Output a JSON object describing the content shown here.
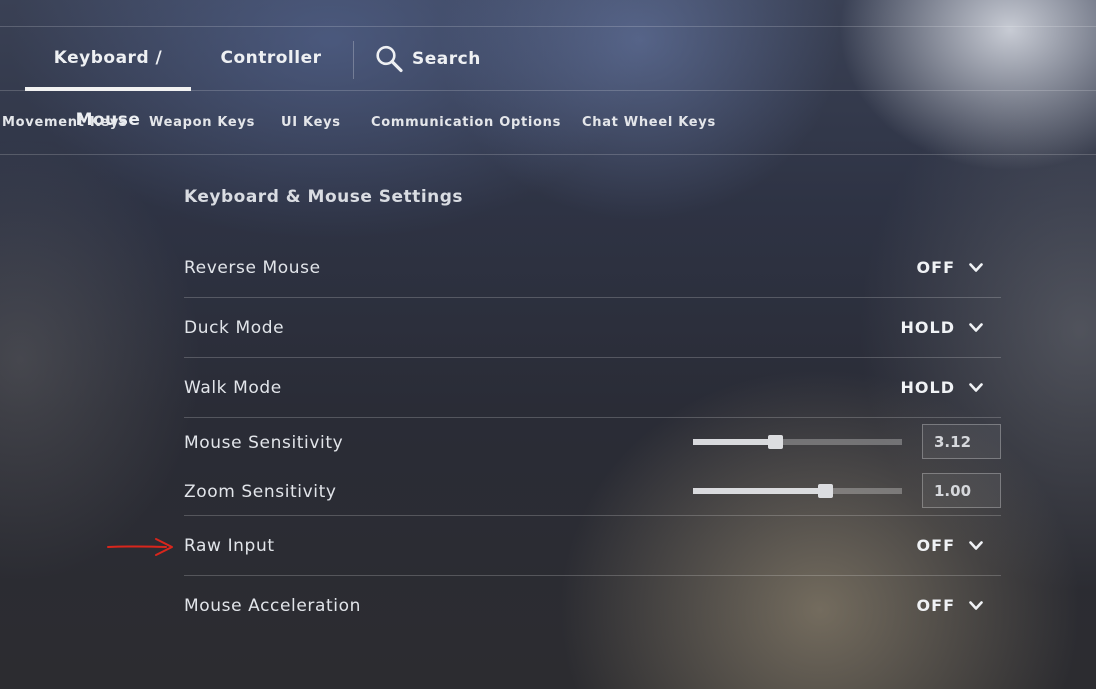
{
  "top_tabs": [
    {
      "label": "Keyboard / Mouse",
      "active": true
    },
    {
      "label": "Controller",
      "active": false
    }
  ],
  "search": {
    "label": "Search",
    "icon": "search-icon"
  },
  "sub_tabs": [
    {
      "label": "Movement Keys"
    },
    {
      "label": "Weapon Keys"
    },
    {
      "label": "UI Keys"
    },
    {
      "label": "Communication Options"
    },
    {
      "label": "Chat Wheel Keys"
    }
  ],
  "section_title": "Keyboard & Mouse Settings",
  "settings": {
    "reverse_mouse": {
      "label": "Reverse Mouse",
      "value": "OFF"
    },
    "duck_mode": {
      "label": "Duck Mode",
      "value": "HOLD"
    },
    "walk_mode": {
      "label": "Walk Mode",
      "value": "HOLD"
    },
    "mouse_sensitivity": {
      "label": "Mouse Sensitivity",
      "value": "3.12",
      "slider_fraction": 0.39
    },
    "zoom_sensitivity": {
      "label": "Zoom Sensitivity",
      "value": "1.00",
      "slider_fraction": 0.63
    },
    "raw_input": {
      "label": "Raw Input",
      "value": "OFF"
    },
    "mouse_acceleration": {
      "label": "Mouse Acceleration",
      "value": "OFF"
    }
  },
  "annotation": {
    "arrow_color": "#d9261c",
    "points_to": "Raw Input"
  },
  "colors": {
    "text": "#e6e8ec",
    "underline": "#f2f2f2",
    "arrow": "#d9261c"
  }
}
